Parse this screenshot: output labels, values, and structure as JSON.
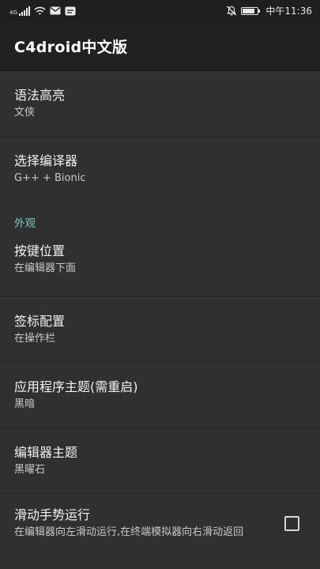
{
  "status_bar": {
    "network_label": "4G",
    "time": "中午11:36",
    "battery_level": 0.85
  },
  "app_bar": {
    "title": "C4droid中文版"
  },
  "preferences": [
    {
      "title": "语法高亮",
      "summary": "文侠"
    },
    {
      "title": "选择编译器",
      "summary": "G++ + Bionic"
    }
  ],
  "category_appearance": "外观",
  "appearance_prefs": [
    {
      "title": "按键位置",
      "summary": "在编辑器下面"
    },
    {
      "title": "签标配置",
      "summary": "在操作栏"
    },
    {
      "title": "应用程序主题(需重启)",
      "summary": "黑暗"
    },
    {
      "title": "编辑器主题",
      "summary": "黑曜石"
    }
  ],
  "swipe_pref": {
    "title": "滑动手势运行",
    "summary": "在编辑器向左滑动运行,在终端模拟器向右滑动返回",
    "checked": false
  }
}
